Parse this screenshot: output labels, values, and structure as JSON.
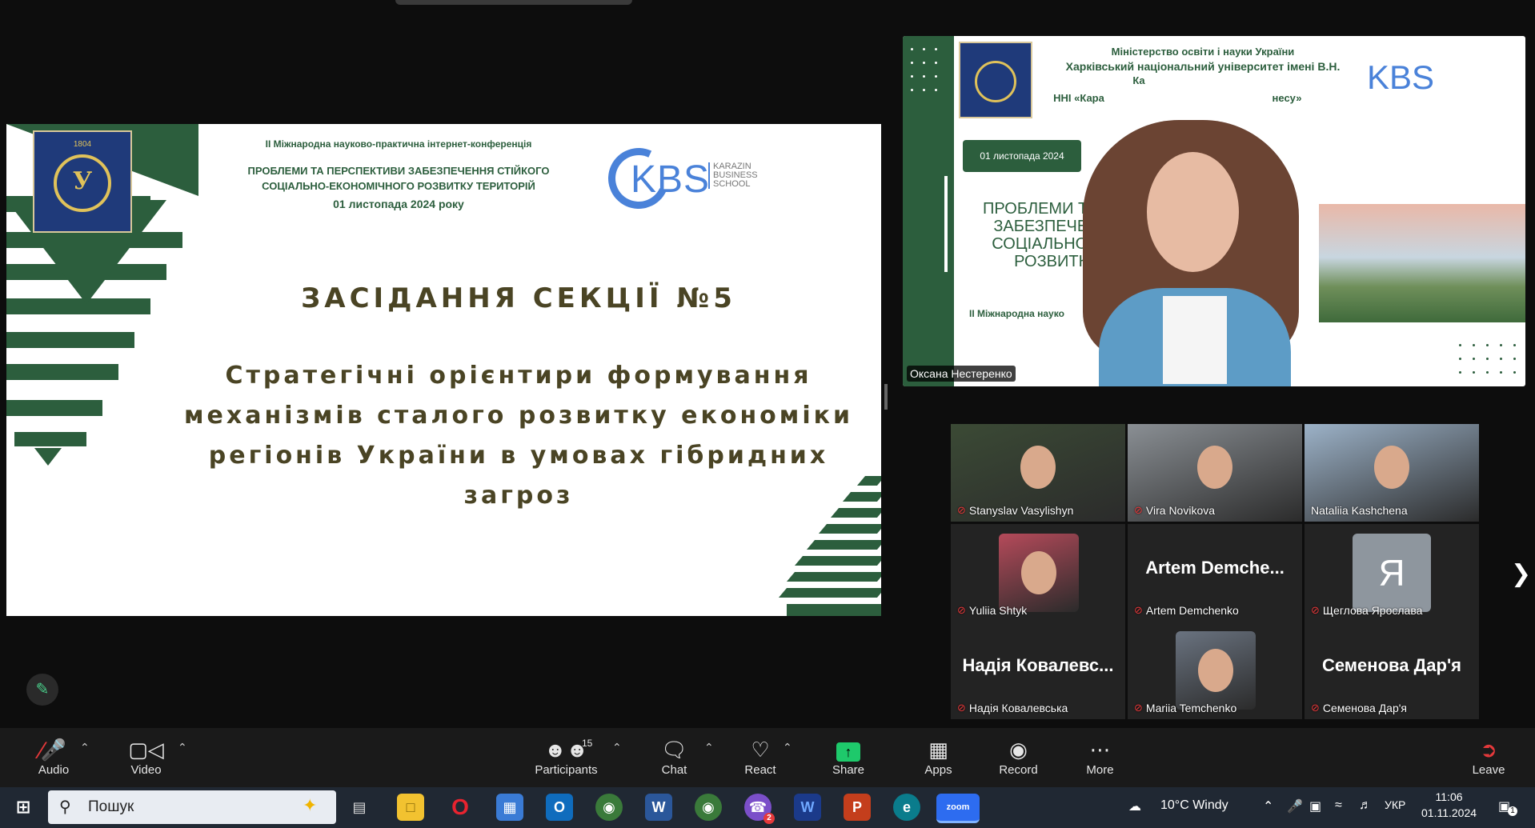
{
  "slide": {
    "conference": "II Міжнародна науково-практична інтернет-конференція",
    "title_line1": "ПРОБЛЕМИ ТА ПЕРСПЕКТИВИ ЗАБЕЗПЕЧЕННЯ СТІЙКОГО",
    "title_line2": "СОЦІАЛЬНО-ЕКОНОМІЧНОГО РОЗВИТКУ ТЕРИТОРІЙ",
    "date": "01 листопада 2024 року",
    "logo_year": "1804",
    "logo_letter": "У",
    "kbs": "KBS",
    "kbs_sub": [
      "KARAZIN",
      "BUSINESS",
      "SCHOOL"
    ],
    "section": "ЗАСІДАННЯ СЕКЦІЇ №5",
    "topic": [
      "Стратегічні орієнтири формування",
      "механізмів сталого розвитку економіки",
      "регіонів України в умовах гібридних загроз"
    ]
  },
  "speaker": {
    "name": "Оксана Нестеренко",
    "hdr1": "Міністерство освіти і науки України",
    "hdr2": "Харківський національний університет імені В.Н.",
    "hdr3": "Ка",
    "hdr4": "ННІ «Кара",
    "hdr4b": "несу»",
    "date": "01 листопада 2024",
    "problem": [
      "ПРОБЛЕМИ Т",
      "ЗАБЕЗПЕЧЕ",
      "СОЦІАЛЬНО",
      "РОЗВИТК"
    ],
    "conf": "II Міжнародна науко"
  },
  "participants": [
    {
      "name": "Stanyslav Vasylishyn",
      "muted": true,
      "video": true
    },
    {
      "name": "Vira Novikova",
      "muted": true,
      "video": true
    },
    {
      "name": "Nataliia Kashchena",
      "muted": false,
      "video": true
    },
    {
      "name": "Yuliia Shtyk",
      "muted": true,
      "video": true
    },
    {
      "name": "Artem Demchenko",
      "display": "Artem  Demche...",
      "muted": true,
      "video": false
    },
    {
      "name": "Щеглова Ярослава",
      "avatar": "Я",
      "muted": true,
      "video": false
    },
    {
      "name": "Надія Ковалевська",
      "display": "Надія  Ковалевс...",
      "muted": true,
      "video": false
    },
    {
      "name": "Mariia Temchenko",
      "muted": true,
      "video": true
    },
    {
      "name": "Семенова Дар'я",
      "display": "Семенова Дар'я",
      "muted": true,
      "video": false
    }
  ],
  "toolbar": {
    "audio": "Audio",
    "video": "Video",
    "participants": "Participants",
    "participants_count": "15",
    "chat": "Chat",
    "react": "React",
    "share": "Share",
    "apps": "Apps",
    "record": "Record",
    "more": "More",
    "leave": "Leave"
  },
  "taskbar": {
    "search": "Пошук",
    "weather": "10°C  Windy",
    "lang": "УКР",
    "time": "11:06",
    "date": "01.11.2024",
    "viber_badge": "2",
    "notif_badge": "1",
    "zoom_label": "zoom"
  },
  "colors": {
    "green": "#2c5e3d",
    "kbs_blue": "#4a82d9",
    "share_green": "#1ec96b",
    "muted_red": "#e5393b"
  }
}
